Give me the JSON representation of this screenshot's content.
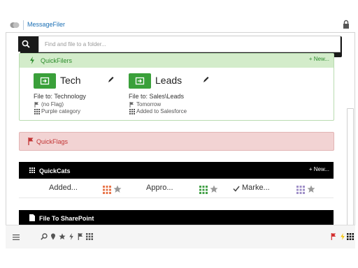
{
  "app": {
    "title": "MessageFiler"
  },
  "search": {
    "placeholder": "Find and file to a folder..."
  },
  "quickfilers": {
    "title": "QuickFilers",
    "new_label": "+ New...",
    "filers": [
      {
        "name": "Tech",
        "file_to": "File to: Technology",
        "flag": "(no Flag)",
        "category": "Purple category"
      },
      {
        "name": "Leads",
        "file_to": "File to: Sales\\Leads",
        "flag": "Tomorrow",
        "category": "Added to Salesforce"
      }
    ]
  },
  "quickflags": {
    "title": "QuickFlags"
  },
  "quickcats": {
    "title": "QuickCats",
    "new_label": "+ New...",
    "items": [
      {
        "label": "Added...",
        "color": "#e8754a"
      },
      {
        "label": "Appro...",
        "color": "#43a047"
      },
      {
        "label": "Marke...",
        "color": "#a090c8",
        "checked": true
      }
    ]
  },
  "sharepoint": {
    "title": "File To SharePoint"
  },
  "colors": {
    "brand": "#1a6fb5",
    "quickfilers_header": "#d3ecca",
    "quickfilers_accent": "#2c8c2c",
    "quickflags_bg": "#f2d3d3",
    "quickflags_accent": "#c23434"
  },
  "icons": [
    "logo-icon",
    "lock-icon",
    "search-icon",
    "bolt-icon",
    "file-arrow-icon",
    "pencil-icon",
    "flag-icon",
    "grid-icon",
    "star-icon",
    "check-icon",
    "document-icon",
    "menu-icon",
    "pin-icon"
  ]
}
